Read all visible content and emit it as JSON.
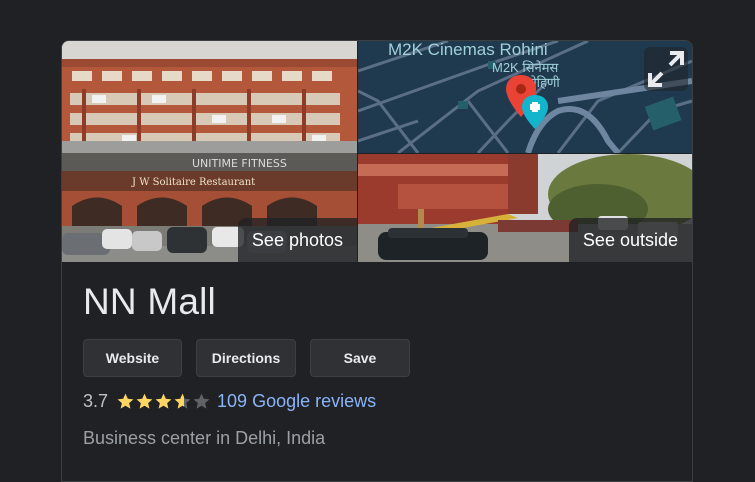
{
  "place": {
    "name": "NN Mall",
    "category": "Business center in Delhi, India",
    "rating": "3.7",
    "rating_value": 3.7,
    "star_count": 5,
    "reviews_label": "109 Google reviews"
  },
  "photos": {
    "see_photos_label": "See photos",
    "see_outside_label": "See outside",
    "main_sign_text": "UNITIME FITNESS",
    "main_sign_text_2": "J W Solitaire Restaurant"
  },
  "map": {
    "poi_name_en": "M2K Cinemas Rohini",
    "poi_name_hi_1": "M2K सिनेमस",
    "poi_name_hi_2": "रोहिणी"
  },
  "actions": {
    "website_label": "Website",
    "directions_label": "Directions",
    "save_label": "Save"
  },
  "colors": {
    "background": "#202124",
    "star_fill": "#fdd663",
    "star_empty": "#5f6368",
    "link": "#8ab4f8",
    "map_road": "#5a6f86",
    "map_bg": "#1f3a4f",
    "pin_red": "#ea4335",
    "pin_teal": "#12b5cb"
  },
  "icons": {
    "expand": "expand-icon",
    "pin": "map-pin-icon",
    "cinema": "cinema-icon",
    "star": "star-icon"
  }
}
